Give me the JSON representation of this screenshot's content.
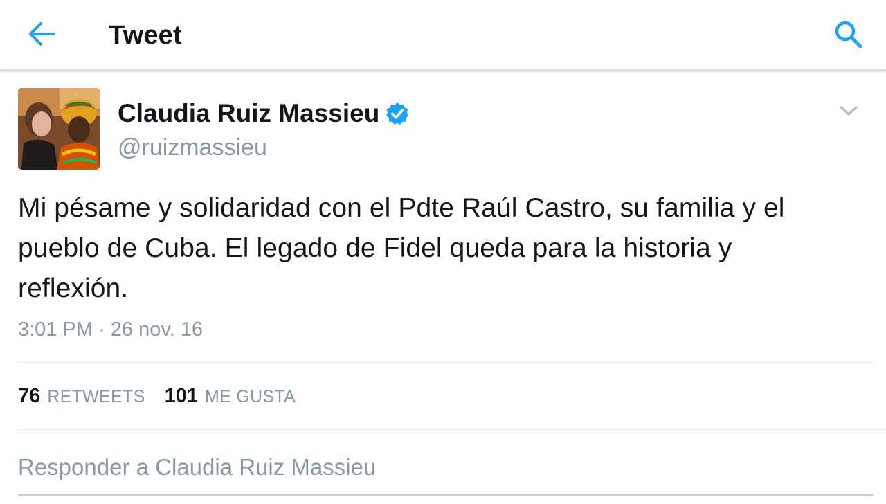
{
  "header": {
    "title": "Tweet",
    "back_icon": "arrow-left-icon",
    "search_icon": "search-icon",
    "accent_color": "#1da1f2"
  },
  "tweet": {
    "author_name": "Claudia Ruiz Massieu",
    "handle": "@ruizmassieu",
    "verified_icon": "verified-badge-icon",
    "more_icon": "chevron-down-icon",
    "text": "Mi pésame y solidaridad con el Pdte Raúl Castro, su familia y el pueblo de Cuba. El legado de Fidel queda para la historia y reflexión.",
    "timestamp": "3:01 PM · 26 nov. 16"
  },
  "stats": {
    "retweets_count": "76",
    "retweets_label": "RETWEETS",
    "likes_count": "101",
    "likes_label": "ME GUSTA"
  },
  "reply": {
    "placeholder": "Responder a Claudia Ruiz Massieu"
  }
}
